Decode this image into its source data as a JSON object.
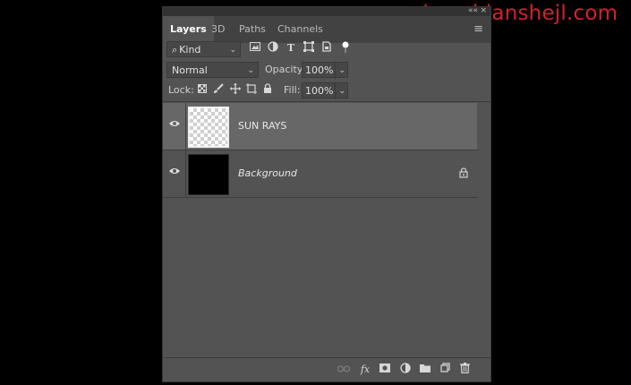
{
  "watermark": "www.haozhianshejl.com",
  "panel": {
    "tabs": [
      {
        "label": "Layers",
        "active": true
      },
      {
        "label": "3D",
        "active": false
      },
      {
        "label": "Paths",
        "active": false
      },
      {
        "label": "Channels",
        "active": false
      }
    ],
    "menu_icon": "≡",
    "collapse_icon": "««",
    "close_icon": "×"
  },
  "filter": {
    "kind_label": "Kind",
    "search_icon": "⌕",
    "icons": [
      "image-filter-icon",
      "adjustment-filter-icon",
      "type-filter-icon",
      "shape-filter-icon",
      "smart-object-filter-icon",
      "filter-toggle-icon"
    ]
  },
  "blend": {
    "mode": "Normal",
    "opacity_label": "Opacity:",
    "opacity_value": "100%"
  },
  "lock": {
    "label": "Lock:",
    "icons": [
      "lock-transparent-icon",
      "lock-pixels-icon",
      "lock-position-icon",
      "lock-artboard-icon",
      "lock-all-icon"
    ],
    "fill_label": "Fill:",
    "fill_value": "100%"
  },
  "layers": [
    {
      "name": "SUN RAYS",
      "selected": true,
      "thumb": "transparent",
      "visible": true,
      "locked": false,
      "italic": false
    },
    {
      "name": "Background",
      "selected": false,
      "thumb": "black",
      "visible": true,
      "locked": true,
      "italic": true
    }
  ],
  "bottom_icons": [
    "link-layers-icon",
    "fx-icon",
    "add-mask-icon",
    "new-adjustment-icon",
    "new-group-icon",
    "new-layer-icon",
    "delete-icon"
  ],
  "colors": {
    "panel_bg": "#535353",
    "selected_layer": "#676767",
    "watermark": "#d2222a"
  }
}
